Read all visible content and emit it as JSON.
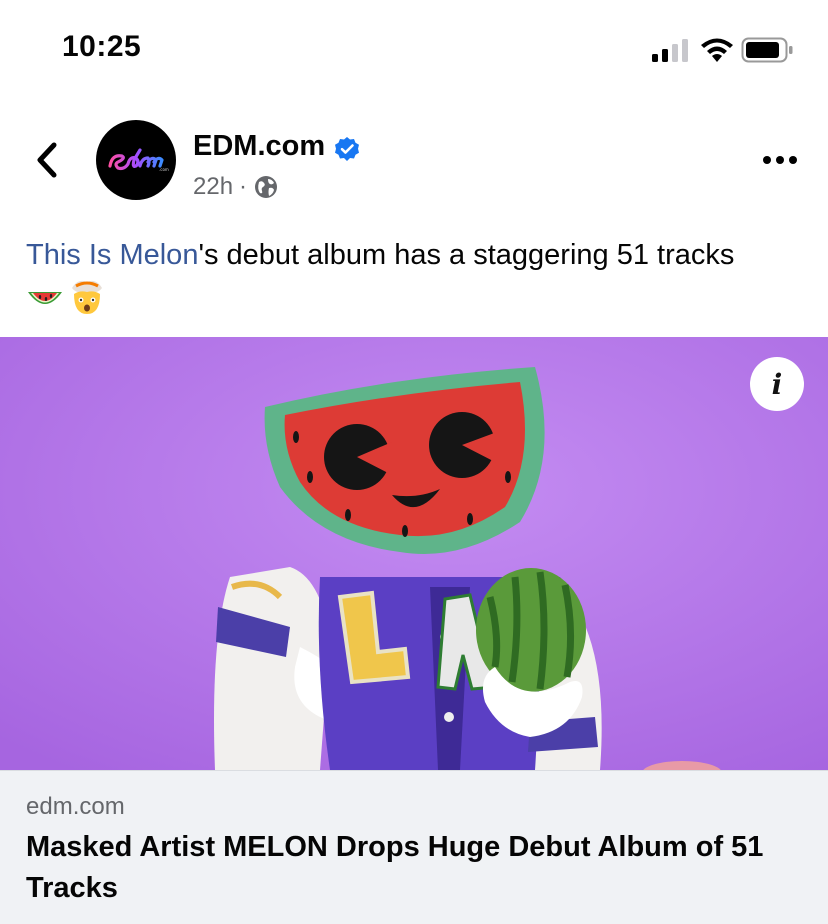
{
  "status_bar": {
    "time": "10:25",
    "icons": [
      "cellular-signal-icon",
      "wifi-icon",
      "battery-icon"
    ]
  },
  "post": {
    "page_name": "EDM.com",
    "avatar_logo_text": "edm",
    "verified": true,
    "timestamp": "22h",
    "separator": "·",
    "audience_icon": "globe-icon",
    "text_mention": "This Is Melon",
    "text_rest": "'s debut album has a staggering 51 tracks",
    "emojis": [
      "watermelon-emoji",
      "exploding-head-emoji"
    ]
  },
  "link_card": {
    "image_description_icon": "info-icon",
    "info_label": "i",
    "domain": "edm.com",
    "title": "Masked Artist MELON Drops Huge Debut Album of 51 Tracks"
  },
  "colors": {
    "mention": "#385898",
    "verified": "#1877f2",
    "caption_bg": "#f0f2f5",
    "image_bg": "#b97ae8"
  }
}
